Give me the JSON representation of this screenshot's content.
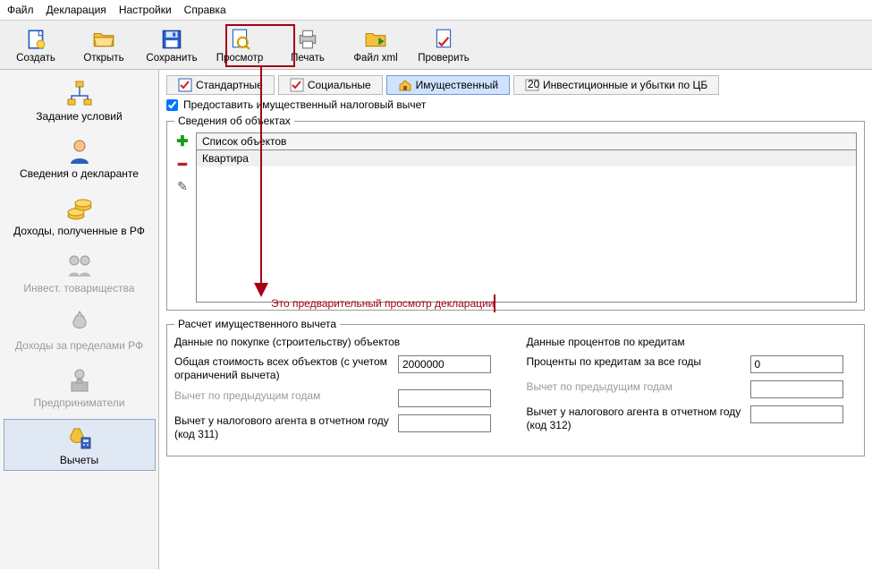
{
  "menu": {
    "file": "Файл",
    "decl": "Декларация",
    "settings": "Настройки",
    "help": "Справка"
  },
  "toolbar": {
    "create": "Создать",
    "open": "Открыть",
    "save": "Сохранить",
    "preview": "Просмотр",
    "print": "Печать",
    "xml": "Файл xml",
    "check": "Проверить"
  },
  "sidebar": {
    "items": [
      {
        "label": "Задание условий"
      },
      {
        "label": "Сведения о декларанте"
      },
      {
        "label": "Доходы, полученные в РФ"
      },
      {
        "label": "Инвест. товарищества"
      },
      {
        "label": "Доходы за пределами РФ"
      },
      {
        "label": "Предприниматели"
      },
      {
        "label": "Вычеты"
      }
    ]
  },
  "tabs": {
    "std": "Стандартные",
    "soc": "Социальные",
    "prop": "Имущественный",
    "inv": "Инвестиционные и убытки по ЦБ",
    "invnum": "20..."
  },
  "provide": "Предоставить имущественный налоговый вычет",
  "objects": {
    "legend": "Сведения об объектах",
    "listhead": "Список объектов",
    "row0": "Квартира"
  },
  "calc": {
    "legend": "Расчет имущественного вычета",
    "left_title": "Данные по покупке (строительству) объектов",
    "right_title": "Данные процентов по кредитам",
    "total_cost_label": "Общая стоимость всех объектов (с учетом ограничений вычета)",
    "total_cost_value": "2000000",
    "interest_label": "Проценты по кредитам за все годы",
    "interest_value": "0",
    "prev_years_label": "Вычет по предыдущим годам",
    "agent311_label": "Вычет у налогового агента в отчетном году (код 311)",
    "agent312_label": "Вычет у налогового агента в отчетном году (код 312)"
  },
  "annotation": {
    "text": "Это предварительный просмотр декларации"
  }
}
